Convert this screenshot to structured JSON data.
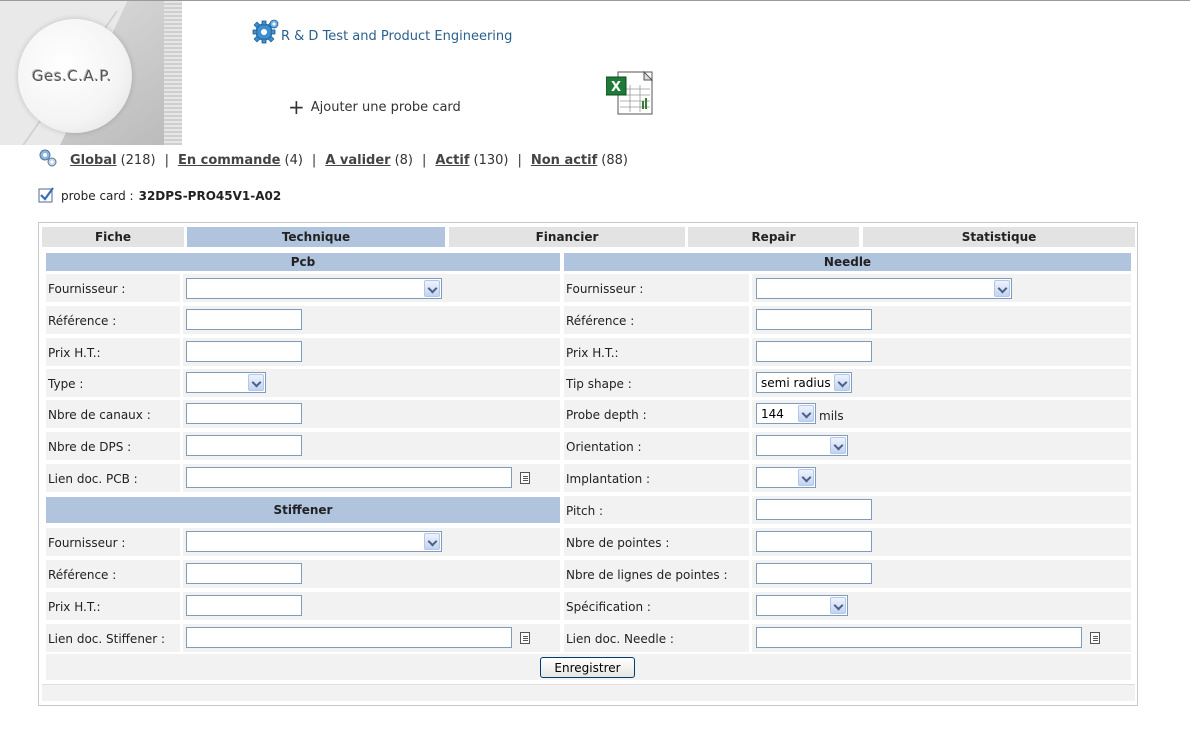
{
  "logo": {
    "text": "Ges.C.A.P."
  },
  "header": {
    "department": "R & D Test and Product Engineering",
    "add_probe_label": "Ajouter une probe card",
    "excel_icon": "excel-icon"
  },
  "filters": [
    {
      "label": "Global",
      "count": "(218)"
    },
    {
      "label": "En commande",
      "count": "(4)"
    },
    {
      "label": "A valider",
      "count": "(8)"
    },
    {
      "label": "Actif",
      "count": "(130)"
    },
    {
      "label": "Non actif",
      "count": "(88)"
    }
  ],
  "filter_sep": "|",
  "probe_card": {
    "label": "probe card :",
    "value": "32DPS-PRO45V1-A02"
  },
  "tabs": [
    {
      "label": "Fiche",
      "active": false
    },
    {
      "label": "Technique",
      "active": true
    },
    {
      "label": "Financier",
      "active": false
    },
    {
      "label": "Repair",
      "active": false
    },
    {
      "label": "Statistique",
      "active": false
    }
  ],
  "pcb": {
    "title": "Pcb",
    "fournisseur": "Fournisseur :",
    "reference": "Référence :",
    "prix": "Prix H.T.:",
    "type": "Type :",
    "nbre_canaux": "Nbre de canaux :",
    "nbre_dps": "Nbre de DPS :",
    "lien_doc": "Lien doc. PCB :"
  },
  "stiffener": {
    "title": "Stiffener",
    "fournisseur": "Fournisseur :",
    "reference": "Référence :",
    "prix": "Prix H.T.:",
    "lien_doc": "Lien doc. Stiffener :"
  },
  "needle": {
    "title": "Needle",
    "fournisseur": "Fournisseur :",
    "reference": "Référence :",
    "prix": "Prix H.T.:",
    "tip_shape": "Tip shape :",
    "tip_shape_value": "semi radius",
    "probe_depth": "Probe depth :",
    "probe_depth_value": "144",
    "probe_depth_unit": "mils",
    "orientation": "Orientation :",
    "implantation": "Implantation :",
    "pitch": "Pitch :",
    "nbre_pointes": "Nbre de pointes :",
    "nbre_lignes": "Nbre de lignes de pointes :",
    "specification": "Spécification :",
    "lien_doc": "Lien doc. Needle :"
  },
  "save_label": "Enregistrer",
  "colors": {
    "header_blue": "#b0c4de",
    "tab_grey": "#e3e3e3",
    "row_grey": "#f2f2f2",
    "link_blue": "#2b5f8c"
  }
}
